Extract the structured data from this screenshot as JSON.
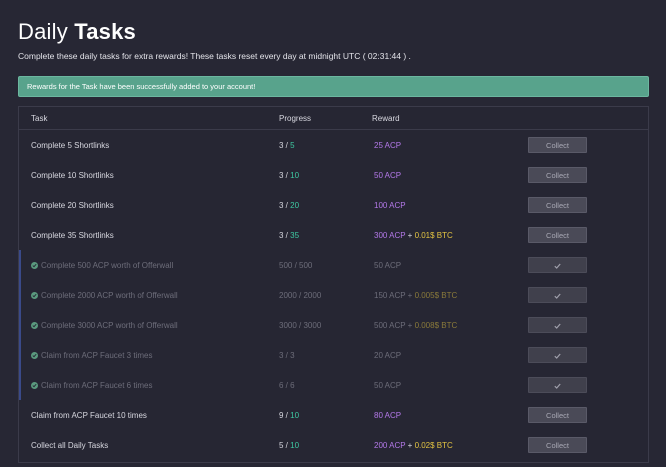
{
  "header": {
    "title_part1": "Daily",
    "title_part2": "Tasks",
    "subtitle": "Complete these daily tasks for extra rewards! These tasks reset every day at midnight UTC ( 02:31:44 ) ."
  },
  "alert": {
    "text": "Rewards for the Task have been successfully added to your account!"
  },
  "table": {
    "headers": {
      "task": "Task",
      "progress": "Progress",
      "reward": "Reward"
    },
    "rows": [
      {
        "task": "Complete 5 Shortlinks",
        "current": "3",
        "total": "5",
        "acp": "25 ACP",
        "btc": "",
        "action": "Collect",
        "done": false,
        "icon": ""
      },
      {
        "task": "Complete 10 Shortlinks",
        "current": "3",
        "total": "10",
        "acp": "50 ACP",
        "btc": "",
        "action": "Collect",
        "done": false,
        "icon": ""
      },
      {
        "task": "Complete 20 Shortlinks",
        "current": "3",
        "total": "20",
        "acp": "100 ACP",
        "btc": "",
        "action": "Collect",
        "done": false,
        "icon": ""
      },
      {
        "task": "Complete 35 Shortlinks",
        "current": "3",
        "total": "35",
        "acp": "300 ACP",
        "btc": "0.01$ BTC",
        "action": "Collect",
        "done": false,
        "icon": ""
      },
      {
        "task": "Complete 500 ACP worth of Offerwall",
        "current": "500",
        "total": "500",
        "acp": "50 ACP",
        "btc": "",
        "action": "check-icon",
        "done": true,
        "icon": "check-circle-icon"
      },
      {
        "task": "Complete 2000 ACP worth of Offerwall",
        "current": "2000",
        "total": "2000",
        "acp": "150 ACP",
        "btc": "0.005$ BTC",
        "action": "check-icon",
        "done": true,
        "icon": "check-circle-icon"
      },
      {
        "task": "Complete 3000 ACP worth of Offerwall",
        "current": "3000",
        "total": "3000",
        "acp": "500 ACP",
        "btc": "0.008$ BTC",
        "action": "check-icon",
        "done": true,
        "icon": "check-circle-icon"
      },
      {
        "task": "Claim from ACP Faucet 3 times",
        "current": "3",
        "total": "3",
        "acp": "20 ACP",
        "btc": "",
        "action": "check-icon",
        "done": true,
        "icon": "check-circle-icon"
      },
      {
        "task": "Claim from ACP Faucet 6 times",
        "current": "6",
        "total": "6",
        "acp": "50 ACP",
        "btc": "",
        "action": "check-icon",
        "done": true,
        "icon": "check-circle-icon"
      },
      {
        "task": "Claim from ACP Faucet 10 times",
        "current": "9",
        "total": "10",
        "acp": "80 ACP",
        "btc": "",
        "action": "Collect",
        "done": false,
        "icon": ""
      },
      {
        "task": "Collect all Daily Tasks",
        "current": "5",
        "total": "10",
        "acp": "200 ACP",
        "btc": "0.02$ BTC",
        "action": "Collect",
        "done": false,
        "icon": ""
      }
    ],
    "separator": " / ",
    "plus": " + "
  },
  "colors": {
    "background": "#272734",
    "alert": "#58a38c",
    "acp": "#b479ea",
    "btc": "#e5c542",
    "progress_total": "#3ec9a2"
  }
}
